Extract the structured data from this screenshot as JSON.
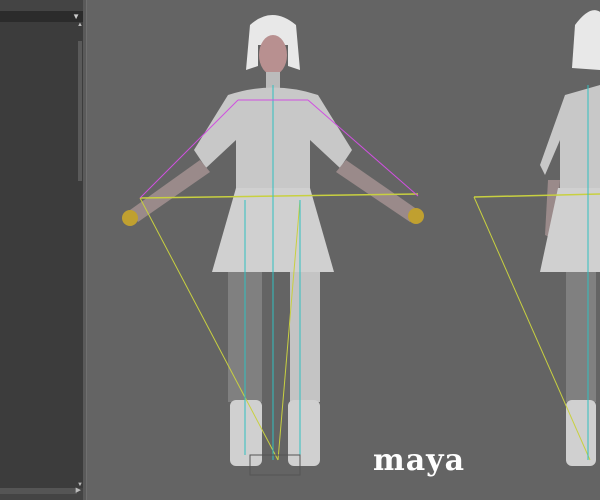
{
  "logo": {
    "text": "maya"
  },
  "outliner": {
    "dropdown_icon": "chevron-down-icon"
  },
  "colors": {
    "viewport_bg": "#646464",
    "panel_bg": "#3c3c3c",
    "joint": "#d050e0",
    "ik": "#c8d040",
    "spine": "#30c0c0"
  }
}
